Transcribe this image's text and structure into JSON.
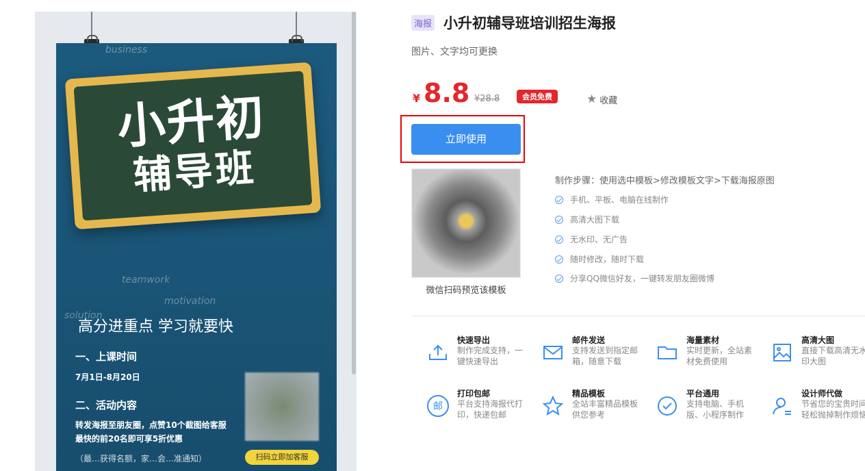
{
  "poster": {
    "doodles": [
      "business",
      "teamwork",
      "motivation",
      "solution"
    ],
    "board_title": "小升初",
    "board_subtitle": "辅导班",
    "headline": "高分进重点 学习就要快",
    "section1": "一、上课时间",
    "dates": "7月1日-8月20日",
    "section2": "二、活动内容",
    "activity_line1": "转发海报至朋友圈，点赞10个截图给客服",
    "activity_line2": "最快的前20名即可享5折优惠",
    "footer_fade": "（最…获得名额，家…会…准通知）",
    "scan_label": "扫码立即加客服"
  },
  "product": {
    "tag": "海报",
    "title": "小升初辅导班培训招生海报",
    "subtitle": "图片、文字均可更换",
    "price_symbol": "¥",
    "price": "8.8",
    "original_price": "¥28.8",
    "vip_badge": "会员免费",
    "favorite_label": "收藏",
    "use_button": "立即使用",
    "qr_caption": "微信扫码预览该模板",
    "steps": "制作步骤：使用选中模板>修改模板文字>下载海报原图",
    "features": [
      "手机、平板、电脑在线制作",
      "高清大图下载",
      "无水印、无广告",
      "随时修改，随时下载",
      "分享QQ微信好友，一键转发朋友圈微博"
    ]
  },
  "services": [
    {
      "icon": "export-icon",
      "title": "快速导出",
      "desc": "制作完成支持，一键快速导出"
    },
    {
      "icon": "mail-icon",
      "title": "邮件发送",
      "desc": "支持发送到指定邮箱，随意下载"
    },
    {
      "icon": "folder-icon",
      "title": "海量素材",
      "desc": "实时更新，全站素材免费使用"
    },
    {
      "icon": "image-icon",
      "title": "高清大图",
      "desc": "直接下载高清无水印大图"
    },
    {
      "icon": "print-mail-icon",
      "title": "打印包邮",
      "icon_text": "邮",
      "desc": "平台支持海报代打印，快递包邮"
    },
    {
      "icon": "star-icon",
      "title": "精品模板",
      "desc": "全站丰富精品模板供您参考"
    },
    {
      "icon": "check-circle-icon",
      "title": "平台通用",
      "desc": "支持电脑、手机版、小程序制作"
    },
    {
      "icon": "designer-icon",
      "title": "设计师代做",
      "desc": "节省您的宝贵时间轻松抛掉制作烦恼"
    }
  ]
}
